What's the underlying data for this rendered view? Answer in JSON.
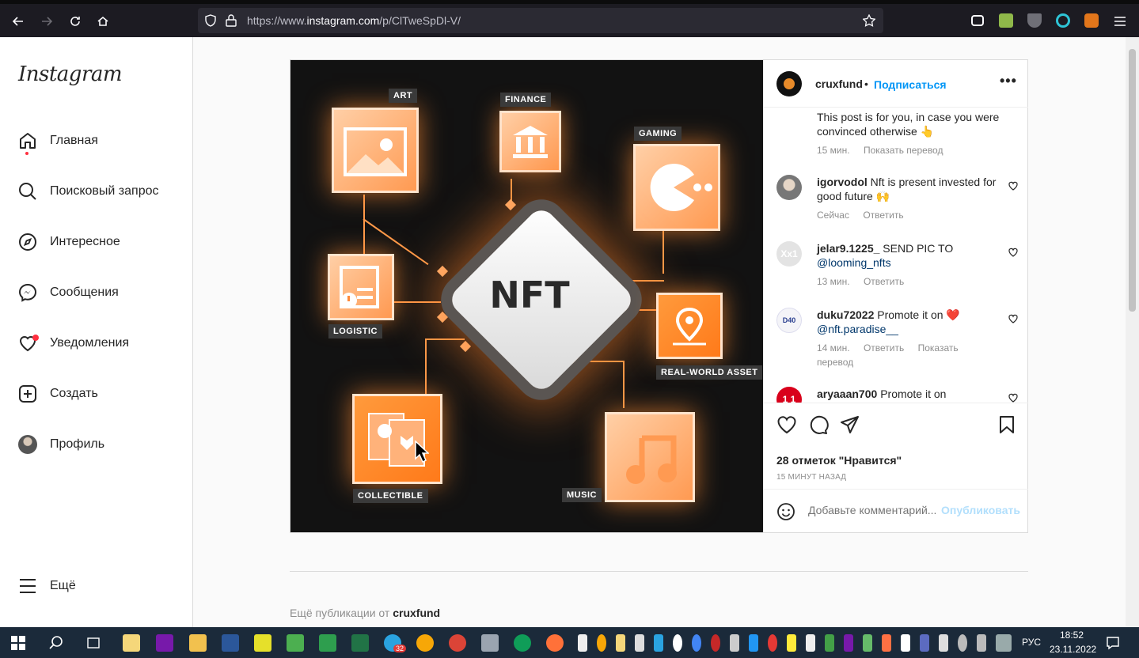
{
  "browser": {
    "url_scheme": "https://www.",
    "url_host": "instagram.com",
    "url_path": "/p/ClTweSpDl-V/"
  },
  "sidebar": {
    "logo": "Instagram",
    "items": [
      {
        "label": "Главная",
        "icon": "home-icon"
      },
      {
        "label": "Поисковый запрос",
        "icon": "search-icon"
      },
      {
        "label": "Интересное",
        "icon": "compass-icon"
      },
      {
        "label": "Сообщения",
        "icon": "messenger-icon"
      },
      {
        "label": "Уведомления",
        "icon": "heart-icon"
      },
      {
        "label": "Создать",
        "icon": "plus-square-icon"
      },
      {
        "label": "Профиль",
        "icon": "avatar"
      }
    ],
    "more_label": "Ещё"
  },
  "post": {
    "image_tags": {
      "art": "ART",
      "finance": "FINANCE",
      "gaming": "GAMING",
      "logistic": "LOGISTIC",
      "real_world": "REAL-WORLD ASSET",
      "collectible": "COLLECTIBLE",
      "music": "MUSIC",
      "center": "NFT"
    },
    "author": "cruxfund",
    "follow_label": "Подписаться",
    "caption": "This post is for you, in case you were convinced otherwise 👆",
    "caption_time": "15 мин.",
    "caption_translate": "Показать перевод",
    "comments": [
      {
        "user": "igorvodol",
        "text": "Nft is present invested for good future 🙌",
        "time": "Сейчас",
        "reply": "Ответить",
        "translate": ""
      },
      {
        "user": "jelar9.1225_",
        "text": "SEND PIC TO",
        "mention": "@looming_nfts",
        "time": "13 мин.",
        "reply": "Ответить",
        "translate": ""
      },
      {
        "user": "duku72022",
        "text": "Promote it on ❤️",
        "mention": "@nft.paradise__",
        "time": "14 мин.",
        "reply": "Ответить",
        "translate": "Показать перевод"
      },
      {
        "user": "aryaaan700",
        "text": "Promote it on"
      }
    ],
    "likes": "28 отметок \"Нравится\"",
    "posted": "15 МИНУТ НАЗАД",
    "comment_placeholder": "Добавьте комментарий...",
    "publish_label": "Опубликовать"
  },
  "more_from": {
    "prefix": "Ещё публикации от",
    "user": "cruxfund"
  },
  "taskbar": {
    "lang": "РУС",
    "time": "18:52",
    "date": "23.11.2022",
    "telegram_badge": "32"
  }
}
